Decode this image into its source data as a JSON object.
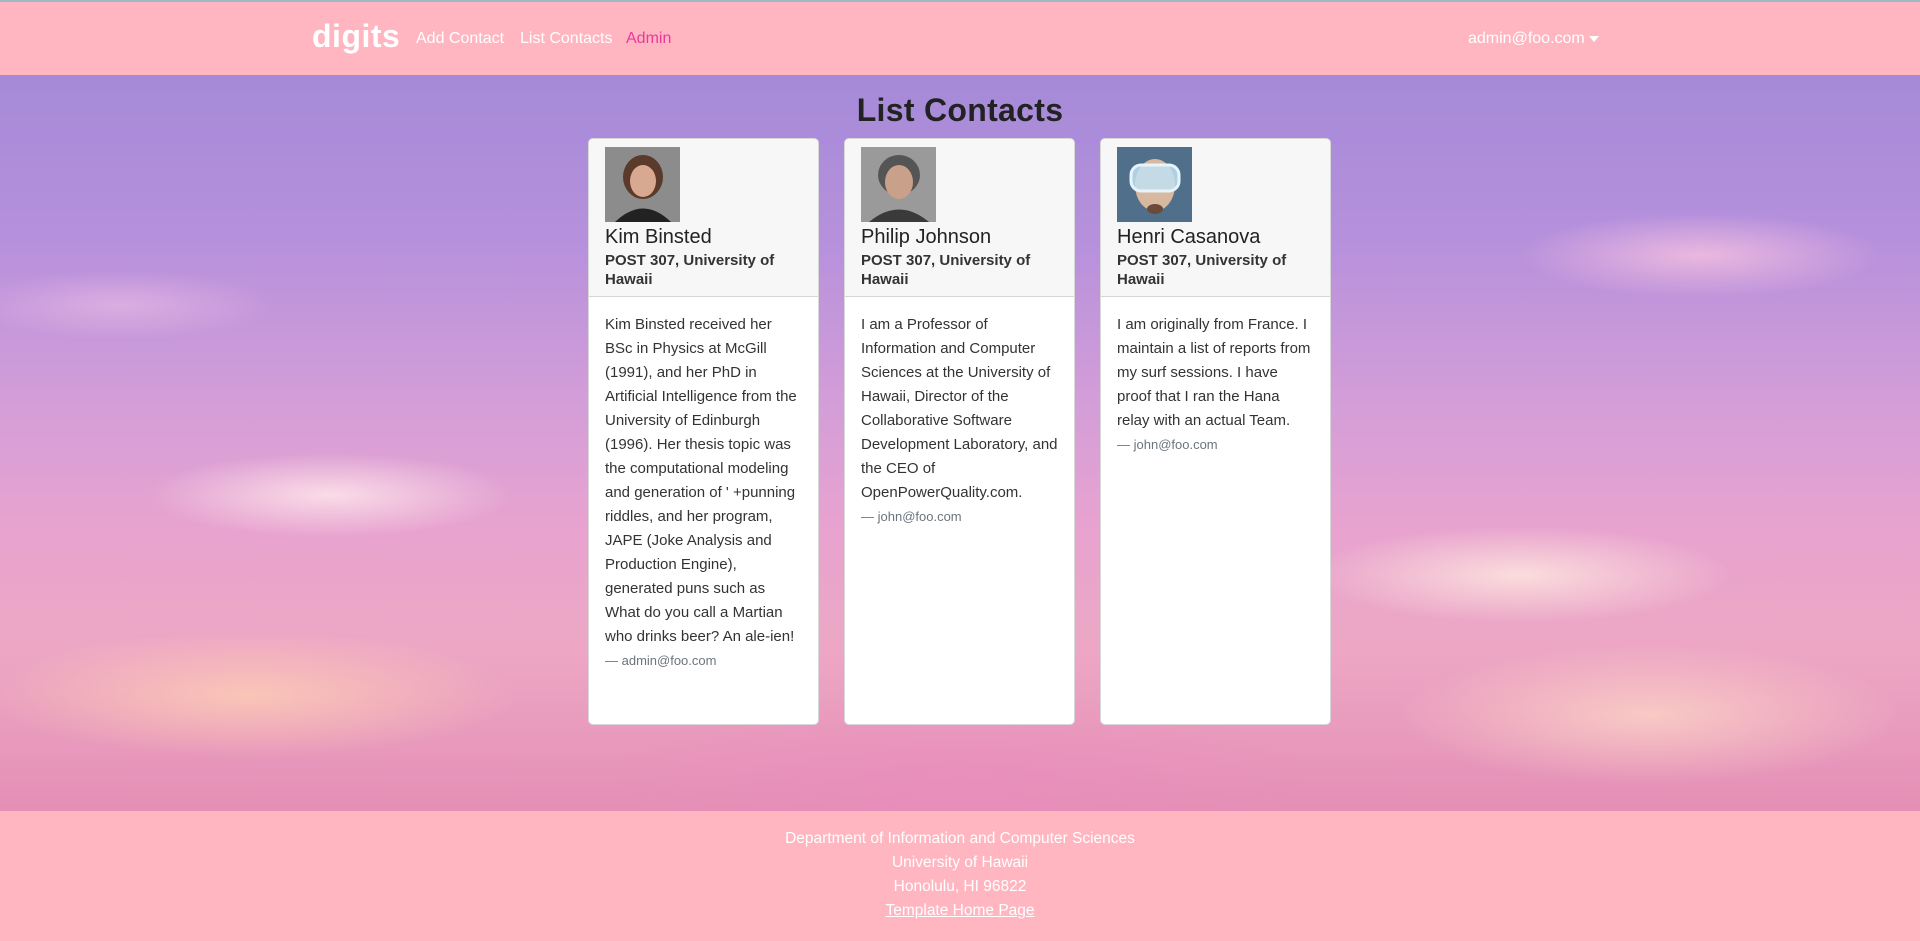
{
  "navbar": {
    "brand": "digits",
    "links": {
      "add_contact": "Add Contact",
      "list_contacts": "List Contacts",
      "admin": "Admin"
    },
    "user": "admin@foo.com",
    "active_color": "#e8399a"
  },
  "page": {
    "title": "List Contacts"
  },
  "contacts": [
    {
      "name": "Kim Binsted",
      "address": "POST 307, University of Hawaii",
      "description": "Kim Binsted received her BSc in Physics at McGill (1991), and her PhD in Artificial Intelligence from the University of Edinburgh (1996). Her thesis topic was the computational modeling and generation of ' +punning riddles, and her program, JAPE (Joke Analysis and Production Engine), generated puns such as What do you call a Martian who drinks beer? An ale-ien!",
      "owner": "— admin@foo.com"
    },
    {
      "name": "Philip Johnson",
      "address": "POST 307, University of Hawaii",
      "description": "I am a Professor of Information and Computer Sciences at the University of Hawaii, Director of the Collaborative Software Development Laboratory, and the CEO of OpenPowerQuality.com.",
      "owner": "— john@foo.com"
    },
    {
      "name": "Henri Casanova",
      "address": "POST 307, University of Hawaii",
      "description": "I am originally from France. I maintain a list of reports from my surf sessions. I have proof that I ran the Hana relay with an actual Team.",
      "owner": "— john@foo.com"
    }
  ],
  "footer": {
    "line1": "Department of Information and Computer Sciences",
    "line2": "University of Hawaii",
    "line3": "Honolulu, HI 96822",
    "link": "Template Home Page"
  },
  "colors": {
    "navbar_bg": "#ffb6c1",
    "footer_bg": "#ffb6c1"
  }
}
